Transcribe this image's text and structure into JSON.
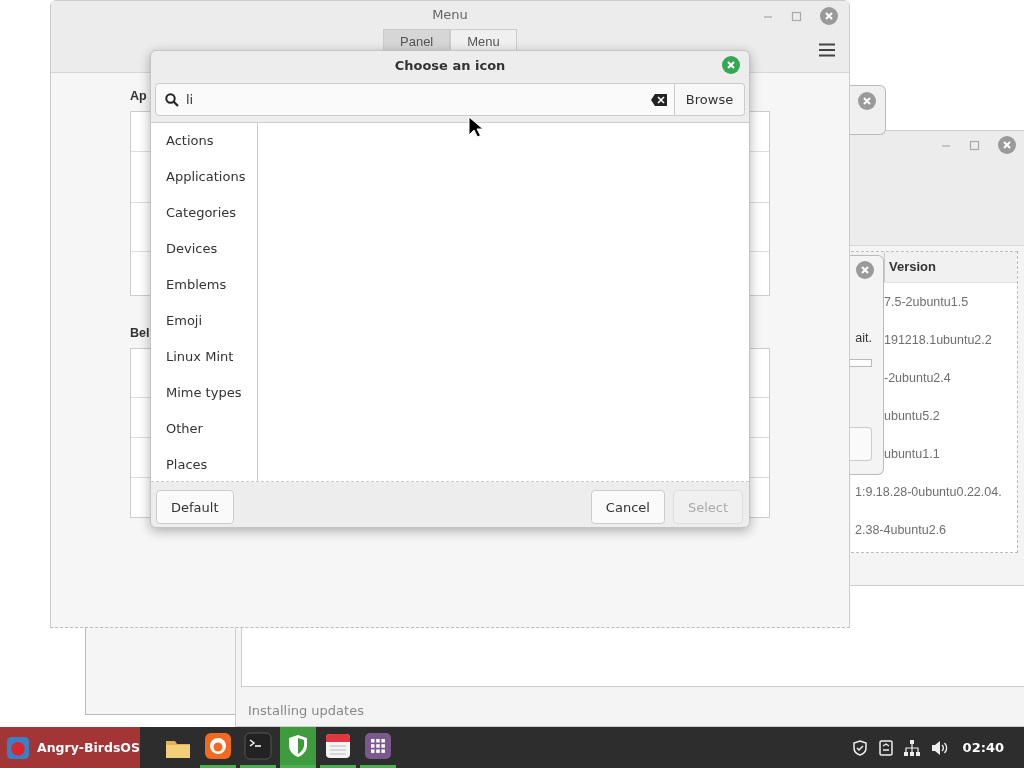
{
  "update_window": {
    "column_header": "Version",
    "versions": [
      "7.5-2ubuntu1.5",
      "191218.1ubuntu2.2",
      "-2ubuntu2.4",
      "ubuntu5.2",
      "ubuntu1.1",
      "1:9.18.28-0ubuntu0.22.04.",
      "2.38-4ubuntu2.6"
    ],
    "status": "Installing updates"
  },
  "progress_dialog": {
    "message": "ait.",
    "level": 0
  },
  "menu_window": {
    "title": "Menu",
    "tabs": [
      {
        "label": "Panel",
        "selected": true
      },
      {
        "label": "Menu",
        "selected": false
      }
    ],
    "section_1": "Ap",
    "section_2": "Bel"
  },
  "icon_dialog": {
    "title": "Choose an icon",
    "search": {
      "value": "li"
    },
    "browse": "Browse",
    "categories": [
      "Actions",
      "Applications",
      "Categories",
      "Devices",
      "Emblems",
      "Emoji",
      "Linux Mint",
      "Mime types",
      "Other",
      "Places"
    ],
    "buttons": [
      {
        "label": "Default",
        "disabled": false
      },
      {
        "label": "Cancel",
        "disabled": false
      },
      {
        "label": "Select",
        "disabled": true
      }
    ]
  },
  "taskbar": {
    "start_label": "Angry-BirdsOS",
    "launchers": [
      {
        "kind": "folder",
        "running": false,
        "active": false
      },
      {
        "kind": "browser",
        "running": true,
        "active": false
      },
      {
        "kind": "terminal",
        "running": true,
        "active": false
      },
      {
        "kind": "shield",
        "running": true,
        "active": true
      },
      {
        "kind": "calendar",
        "running": true,
        "active": false
      },
      {
        "kind": "apps",
        "running": true,
        "active": false
      }
    ],
    "clock": "02:40"
  }
}
